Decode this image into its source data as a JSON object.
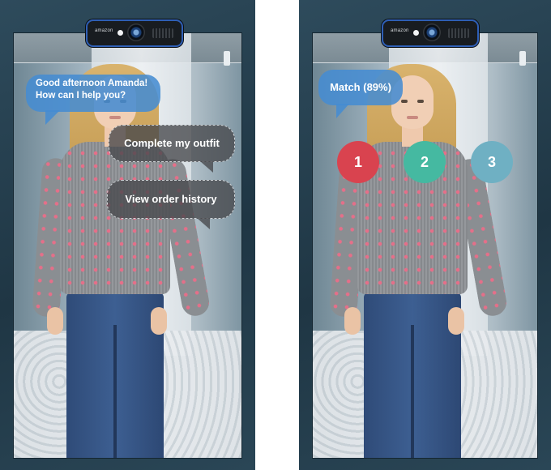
{
  "left_mirror": {
    "camera_brand": "amazon",
    "greeting": {
      "line1": "Good afternoon Amanda!",
      "line2": "How can I help you?"
    },
    "options": [
      {
        "label": "Complete my outfit"
      },
      {
        "label": "View order history"
      }
    ]
  },
  "right_mirror": {
    "camera_brand": "amazon",
    "match_label": "Match (89%)",
    "choices": [
      {
        "label": "1",
        "color": "#d9434f"
      },
      {
        "label": "2",
        "color": "#45b9a1"
      },
      {
        "label": "3",
        "color": "#6fb0c3"
      }
    ]
  },
  "colors": {
    "bubble_blue": "#468cd2",
    "bubble_dark": "#46484c",
    "mirror_frame": "#1f3644",
    "camera_ring": "#2e5fb6"
  }
}
